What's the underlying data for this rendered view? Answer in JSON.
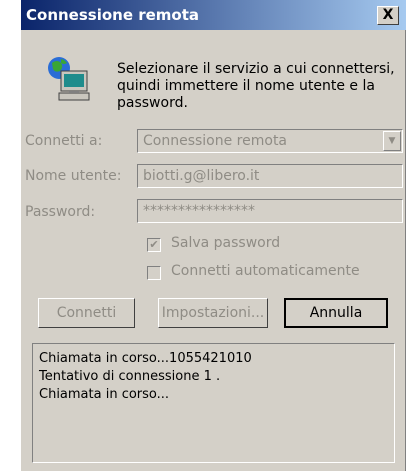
{
  "window": {
    "title": "Connessione remota",
    "close_glyph": "X"
  },
  "intro_text": "Selezionare il servizio a cui connettersi, quindi immettere il nome utente e la password.",
  "icons": {
    "main": "dialup-computer-icon"
  },
  "fields": {
    "connect_to": {
      "label": "Connetti a:",
      "value": "Connessione remota"
    },
    "username": {
      "label": "Nome utente:",
      "value": "biotti.g@libero.it"
    },
    "password": {
      "label": "Password:",
      "value": "****************"
    }
  },
  "checkboxes": {
    "save_password": {
      "label": "Salva password",
      "checked": true
    },
    "auto_connect": {
      "label": "Connetti automaticamente",
      "checked": false
    }
  },
  "buttons": {
    "connect": "Connetti",
    "settings": "Impostazioni...",
    "cancel": "Annulla"
  },
  "log": [
    "Chiamata in corso...1055421010",
    "Tentativo di connessione 1 .",
    "Chiamata in corso..."
  ]
}
